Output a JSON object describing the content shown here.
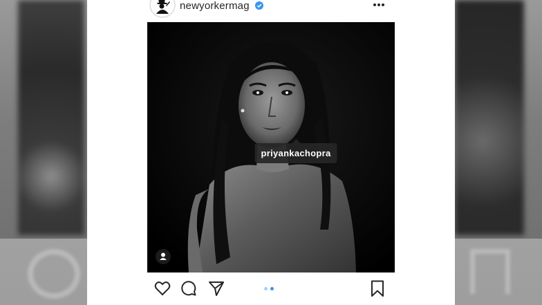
{
  "post": {
    "username": "newyorkermag",
    "photo_tag": "priyankachopra",
    "carousel": {
      "count": 2,
      "active_index": 1
    }
  },
  "icons": {
    "avatar": "eustace-tilley-logo",
    "verified": "verified-badge-icon",
    "more": "more-options-icon",
    "tag": "user-tag-icon",
    "like": "heart-icon",
    "comment": "comment-icon",
    "share": "send-icon",
    "save": "bookmark-icon"
  },
  "colors": {
    "verified_blue": "#3897f0",
    "dot_active": "#3897f0",
    "dot_inactive": "#a8d0f5",
    "icon": "#262626"
  }
}
